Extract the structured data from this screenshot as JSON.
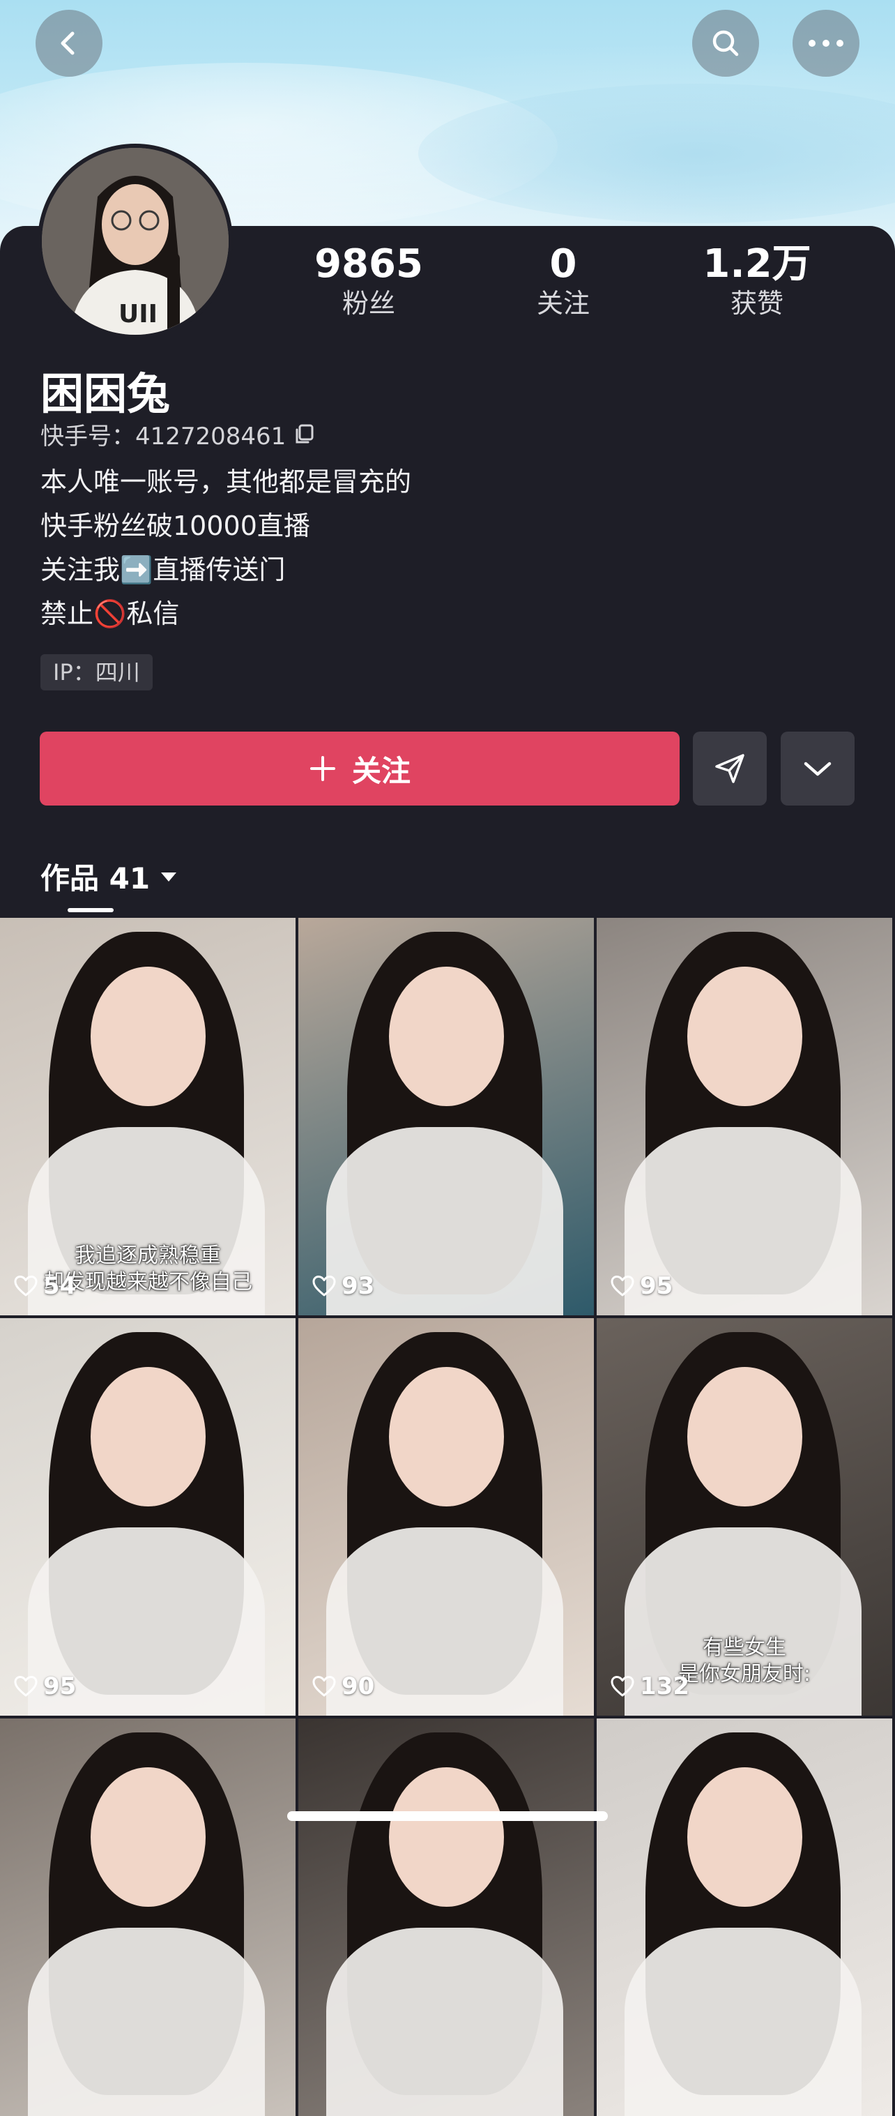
{
  "header": {
    "back_icon": "chevron-left-icon",
    "search_icon": "search-icon",
    "more_icon": "more-dots-icon"
  },
  "profile": {
    "name": "困困兔",
    "kuaishou_id_label": "快手号：4127208461",
    "copy_icon": "copy-icon",
    "stats": [
      {
        "value": "9865",
        "label": "粉丝"
      },
      {
        "value": "0",
        "label": "关注"
      },
      {
        "value": "1.2万",
        "label": "获赞"
      }
    ],
    "bio": [
      "本人唯一账号，其他都是冒充的",
      "快手粉丝破10000直播",
      "关注我➡️直播传送门",
      "禁止🚫私信"
    ],
    "ip": "IP：四川"
  },
  "actions": {
    "follow_label": "关注",
    "plus_icon": "plus-icon",
    "send_icon": "send-icon",
    "expand_icon": "chevron-down-icon",
    "follow_color": "#e04461"
  },
  "tabs": {
    "works_label": "作品 41",
    "dropdown_icon": "caret-down-icon"
  },
  "videos": [
    {
      "likes": "54",
      "caption": [
        "我追逐成熟稳重",
        "却发现越来越不像自己"
      ]
    },
    {
      "likes": "93",
      "caption": []
    },
    {
      "likes": "95",
      "caption": []
    },
    {
      "likes": "95",
      "caption": []
    },
    {
      "likes": "90",
      "caption": []
    },
    {
      "likes": "132",
      "caption": [
        "有些女生",
        "是你女朋友时:"
      ]
    },
    {
      "likes": "",
      "caption": []
    },
    {
      "likes": "",
      "caption": []
    },
    {
      "likes": "",
      "caption": []
    }
  ]
}
